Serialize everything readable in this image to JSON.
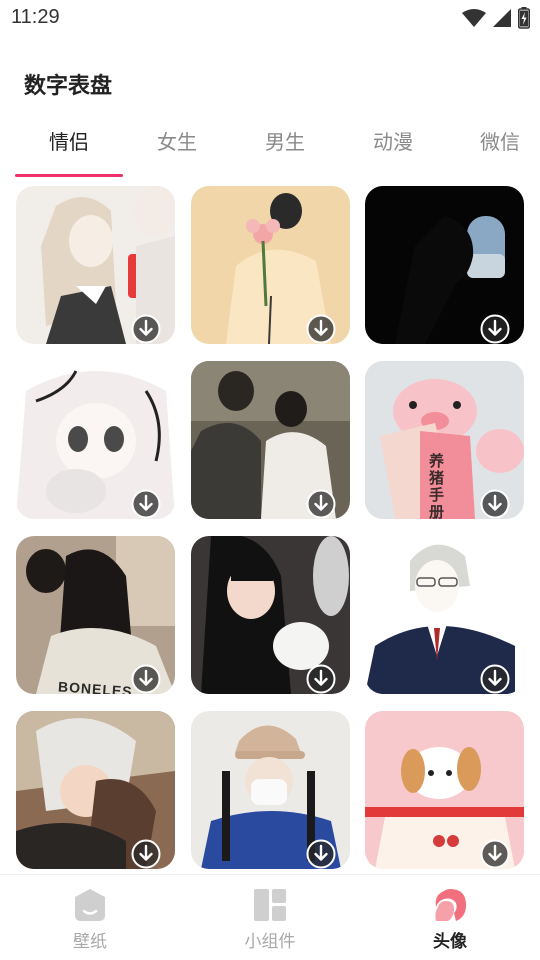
{
  "status_bar": {
    "time": "11:29",
    "icons": [
      "wifi-icon",
      "signal-icon",
      "battery-charging-icon"
    ]
  },
  "app_title": "数字表盘",
  "tabs": [
    {
      "label": "情侣",
      "active": true
    },
    {
      "label": "女生",
      "active": false
    },
    {
      "label": "男生",
      "active": false
    },
    {
      "label": "动漫",
      "active": false
    },
    {
      "label": "微信",
      "active": false
    }
  ],
  "tiles": [
    {
      "subject": "anime couple selfie",
      "text": ""
    },
    {
      "subject": "person holding rose",
      "text": ""
    },
    {
      "subject": "silhouette at airplane window",
      "text": ""
    },
    {
      "subject": "anime girl with cat",
      "text": ""
    },
    {
      "subject": "wedding couple",
      "text": ""
    },
    {
      "subject": "pig reading book",
      "text": "养猪手册"
    },
    {
      "subject": "couple hugging",
      "text": "BONELES"
    },
    {
      "subject": "girl with white dog",
      "text": ""
    },
    {
      "subject": "anime man in suit",
      "text": ""
    },
    {
      "subject": "anime couple embrace",
      "text": ""
    },
    {
      "subject": "girl in cap with peace sign",
      "text": ""
    },
    {
      "subject": "puppy on cherry box",
      "text": ""
    }
  ],
  "bottom_nav": [
    {
      "label": "壁纸",
      "icon": "wallpaper-icon",
      "active": false
    },
    {
      "label": "小组件",
      "icon": "widgets-icon",
      "active": false
    },
    {
      "label": "头像",
      "icon": "avatar-icon",
      "active": true
    }
  ],
  "colors": {
    "accent": "#f0306a",
    "active_nav_icon": "#f26f7e",
    "inactive": "#c8c8c8"
  }
}
